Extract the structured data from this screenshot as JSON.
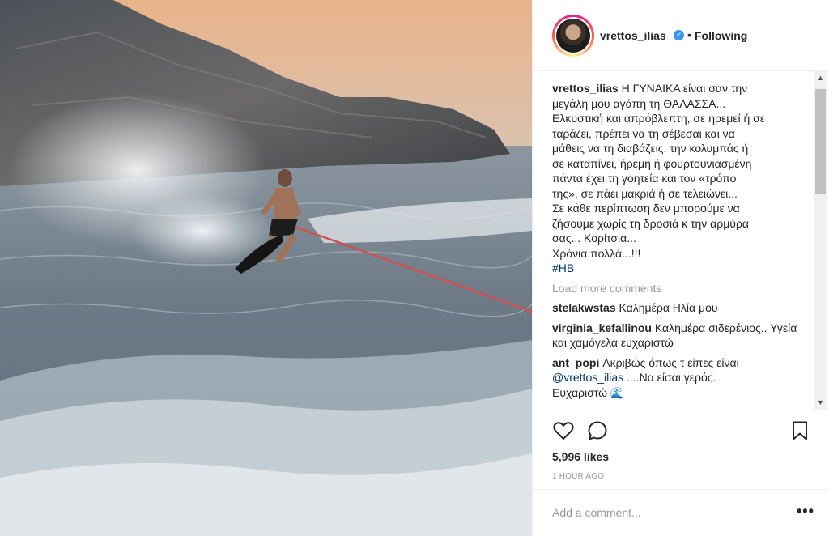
{
  "post": {
    "photo_alt": "",
    "username": "vrettos_ilias",
    "verified_icon": "verified-badge-icon",
    "separator": "•",
    "follow_status": "Following"
  },
  "caption": {
    "username": "vrettos_ilias",
    "lines": [
      "Η ΓΥΝΑΙΚΑ είναι σαν την",
      "μεγάλη μου αγάπη τη ΘΑΛΑΣΣΑ...",
      "Ελκυστική και απρόβλεπτη, σε ηρεμεί ή σε",
      "ταράζει, πρέπει να τη σέβεσαι και να",
      "μάθεις να τη διαβάζεις, την κολυμπάς ή",
      "σε καταπίνει, ήρεμη ή φουρτουνιασμένη",
      "πάντα έχει τη γοητεία και τον «τρόπο",
      "της», σε πάει μακριά ή σε τελειώνει...",
      "Σε κάθε περίπτωση δεν μπορούμε να",
      "ζήσουμε χωρίς τη δροσιά κ την αρμύρα",
      "σας... Κορίτσια...",
      "Χρόνια πολλά...!!!"
    ],
    "hashtag": "#HB"
  },
  "load_more": "Load more comments",
  "comments": [
    {
      "username": "stelakwstas",
      "text": "Καλημέρα Ηλία μου"
    },
    {
      "username": "virginia_kefallinou",
      "text": "Καλημέρα σιδερένιος.. Υγεία και χαμόγελα ευχαριστώ"
    },
    {
      "username": "ant_popi",
      "text": "Ακριβώς όπως τ είπες είναι",
      "mention": "@vrettos_ilias",
      "text2": "....Να είσαι γερός.",
      "text3": "Ευχαριστώ 🌊"
    }
  ],
  "actions": {
    "like_icon": "heart-icon",
    "comment_icon": "comment-bubble-icon",
    "save_icon": "bookmark-icon"
  },
  "likes": "5,996 likes",
  "time": "1 HOUR AGO",
  "add_comment": {
    "placeholder": "Add a comment..."
  },
  "more_label": "•••",
  "colors": {
    "link": "#003569",
    "muted": "#999999",
    "verified": "#3897f0",
    "text": "#262626"
  }
}
